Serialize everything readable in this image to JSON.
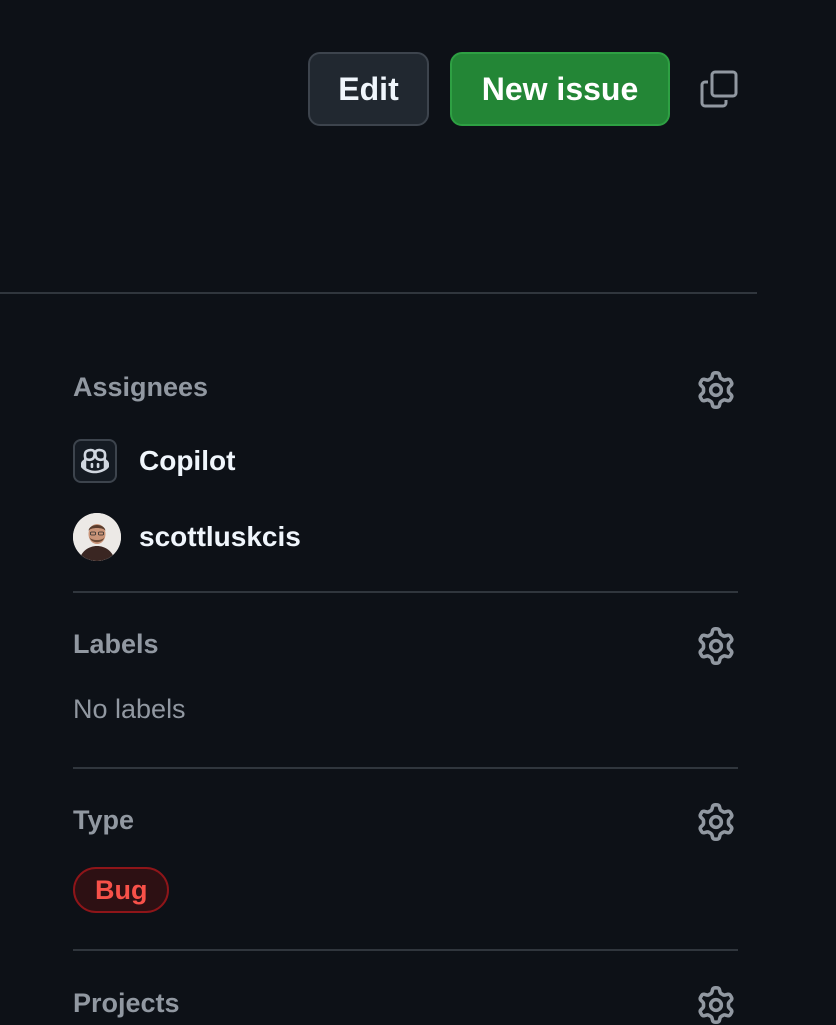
{
  "header": {
    "edit_label": "Edit",
    "new_issue_label": "New issue",
    "copy_icon": "copy-icon"
  },
  "sidebar": {
    "assignees": {
      "title": "Assignees",
      "items": [
        {
          "name": "Copilot",
          "avatar": "copilot-icon"
        },
        {
          "name": "scottluskcis",
          "avatar": "user-avatar"
        }
      ]
    },
    "labels": {
      "title": "Labels",
      "empty_text": "No labels"
    },
    "type": {
      "title": "Type",
      "value": "Bug"
    },
    "projects": {
      "title": "Projects"
    }
  },
  "colors": {
    "background": "#0d1117",
    "primary_button": "#238636",
    "bug_label_text": "#f85149",
    "bug_label_border": "#8e1519",
    "muted_text": "#9198a1",
    "divider": "#30363d"
  }
}
